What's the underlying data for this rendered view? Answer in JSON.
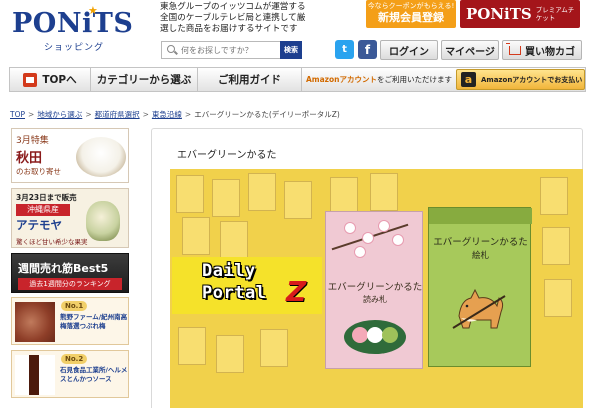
{
  "header": {
    "logo_text": "PONiTS",
    "logo_sub": "ショッピング",
    "tagline": "東急グループのイッツコムが運営する全国のケーブルテレビ局と連携して厳選した商品をお届けするサイトです",
    "search_placeholder": "何をお探しですか？",
    "search_button": "検索",
    "promo_new_small": "今ならクーポンがもらえる!",
    "promo_new_big": "新規会員登録",
    "promo_premium_brand": "PONiTS",
    "promo_premium_tag": "プレミアムチケット",
    "twitter_label": "t",
    "facebook_label": "f",
    "login": "ログイン",
    "mypage": "マイページ",
    "cart": "買い物カゴ"
  },
  "nav": {
    "home": "TOPへ",
    "category": "カテゴリーから選ぶ",
    "guide": "ご利用ガイド",
    "amazon_word": "Amazonアカウント",
    "amazon_rest": "をご利用いただけます",
    "amazon_btn_icon": "a",
    "amazon_btn": "Amazonアカウントでお支払い"
  },
  "breadcrumb": {
    "items": [
      "TOP",
      "地域から選ぶ",
      "都道府県選択",
      "東急沿線"
    ],
    "current": "エバーグリーンかるた(デイリーポータルZ)"
  },
  "sidebar": {
    "akita": {
      "issue": "3月特集",
      "title": "秋田",
      "sub": "のお取り寄せ"
    },
    "ate": {
      "date": "3月23日まで販売",
      "region": "沖縄県産",
      "title": "アテモヤ",
      "sub": "驚くほど甘い希少な果実"
    },
    "weekly": {
      "title": "週間売れ筋Best5",
      "sub": "過去1週間分のランキング"
    },
    "ranks": [
      {
        "medal": "No.1",
        "text": "熊野ファーム/紀州南高梅落選つぶれ梅"
      },
      {
        "medal": "No.2",
        "text": "石見食品工業所/ヘルメスとんかつソース"
      }
    ]
  },
  "main": {
    "title": "エバーグリーンかるた",
    "photo": {
      "dp_line1": "Daily",
      "dp_line2": "Portal",
      "dp_z": "Z",
      "pink_title": "エバーグリーンかるた",
      "pink_sub": "読み札",
      "green_title": "エバーグリーンかるた",
      "green_sub": "絵札"
    }
  },
  "colors": {
    "brand_blue": "#1d3f8f",
    "accent_orange": "#f49f18",
    "premium_red": "#a4151a",
    "photo_yellow": "#f1d14b"
  }
}
